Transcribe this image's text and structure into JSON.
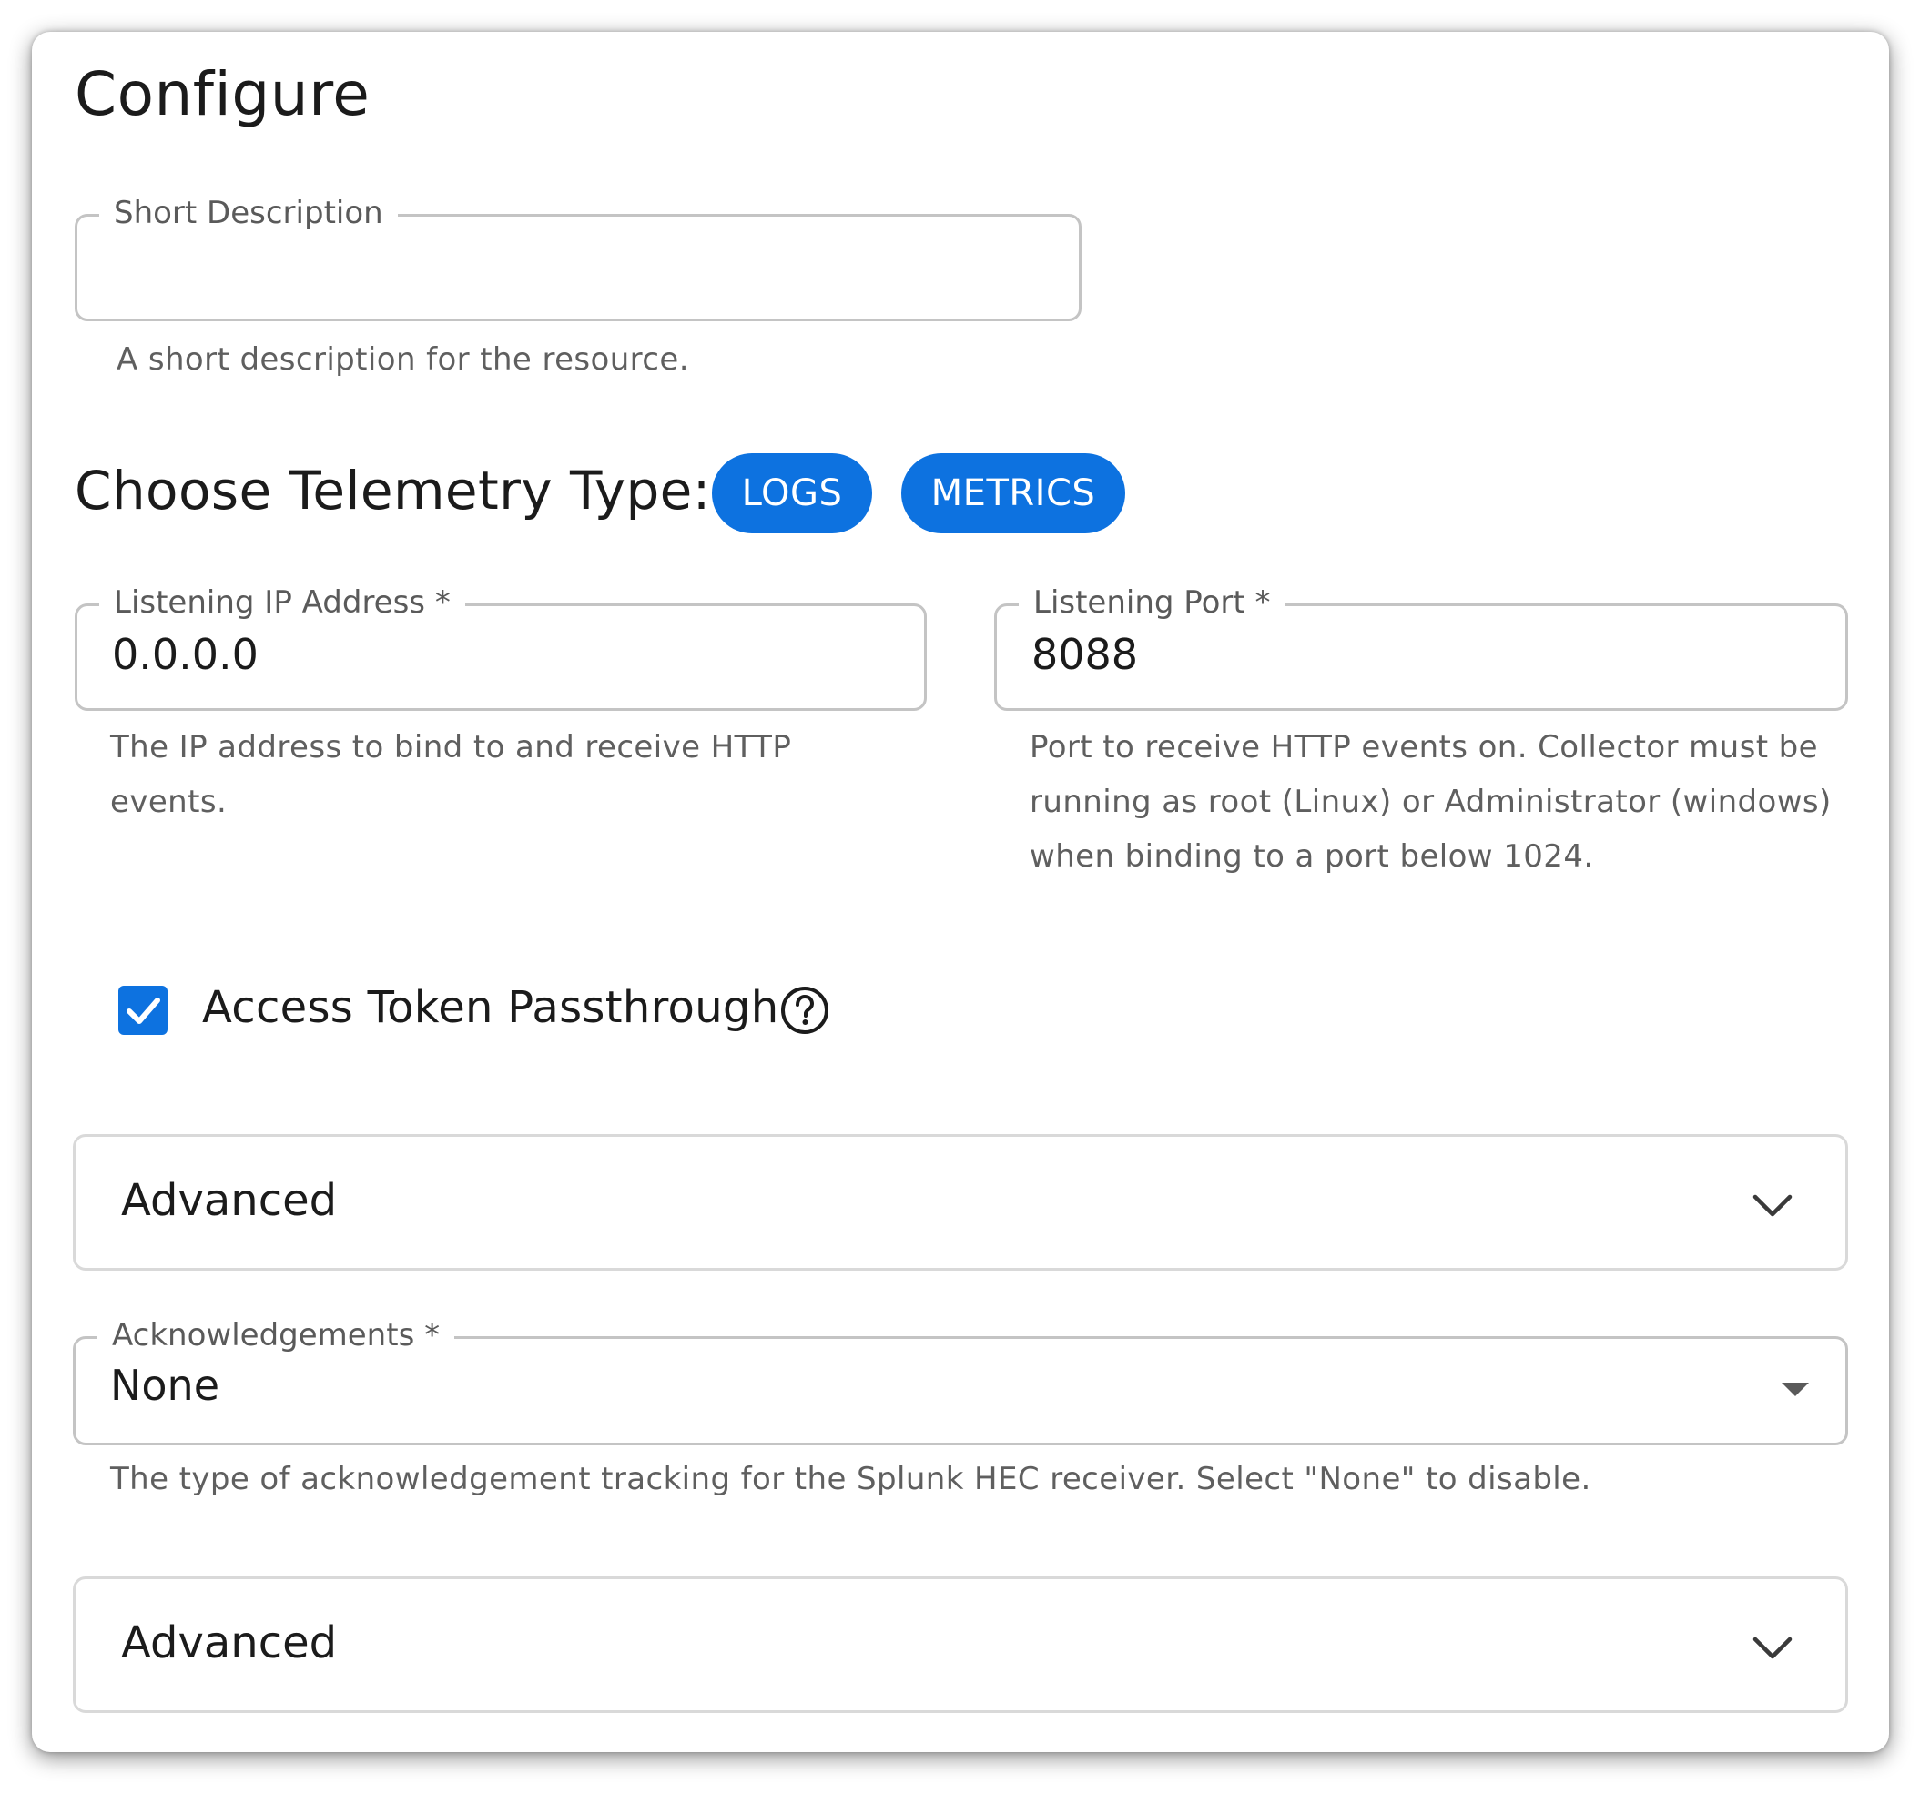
{
  "page": {
    "title": "Configure"
  },
  "short_description": {
    "label": "Short Description",
    "value": "",
    "helper": "A short description for the resource."
  },
  "telemetry": {
    "heading": "Choose Telemetry Type:",
    "chips": [
      "LOGS",
      "METRICS"
    ],
    "chip_color": "#0d72e0"
  },
  "listening_ip": {
    "label": "Listening IP Address *",
    "value": "0.0.0.0",
    "helper": "The IP address to bind to and receive HTTP events."
  },
  "listening_port": {
    "label": "Listening Port *",
    "value": "8088",
    "helper": "Port to receive HTTP events on. Collector must be running as root (Linux) or Administrator (windows) when binding to a port below 1024."
  },
  "access_token": {
    "label": "Access Token Passthrough",
    "checked": true,
    "help_icon": "question-circle-icon"
  },
  "advanced_1": {
    "label": "Advanced",
    "icon": "chevron-down-icon"
  },
  "acknowledgements": {
    "label": "Acknowledgements *",
    "value": "None",
    "helper": "The type of acknowledgement tracking for the Splunk HEC receiver. Select \"None\" to disable."
  },
  "advanced_2": {
    "label": "Advanced",
    "icon": "chevron-down-icon"
  }
}
